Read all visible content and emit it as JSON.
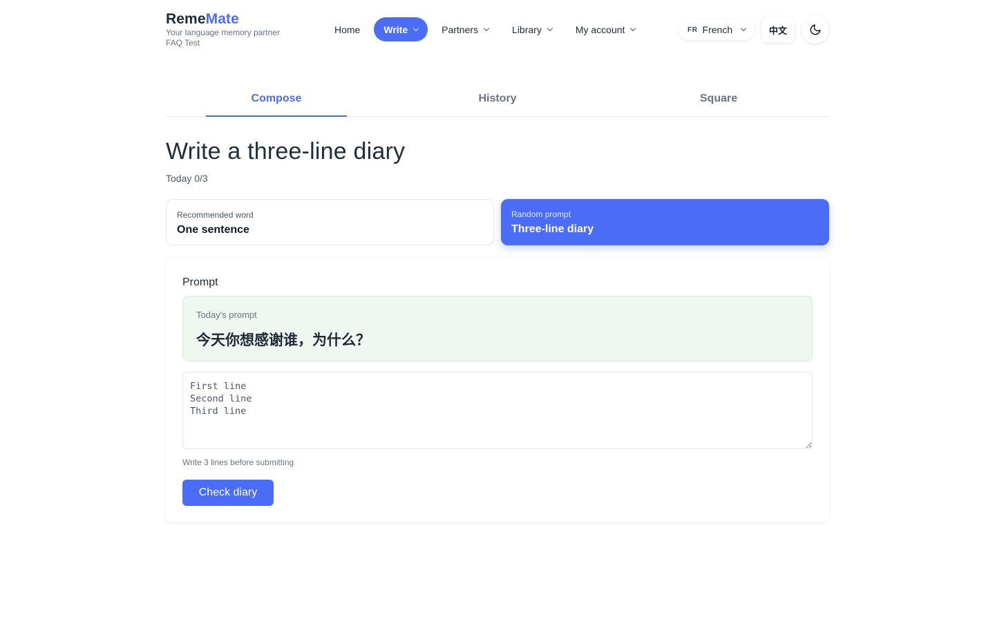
{
  "brand": {
    "name_part1": "Reme",
    "name_part2": "Mate",
    "tagline": "Your language memory partner",
    "subtitle": "FAQ Test"
  },
  "nav": {
    "items": [
      {
        "label": "Home",
        "active": false,
        "dropdown": false
      },
      {
        "label": "Write",
        "active": true,
        "dropdown": true
      },
      {
        "label": "Partners",
        "active": false,
        "dropdown": true
      },
      {
        "label": "Library",
        "active": false,
        "dropdown": true
      },
      {
        "label": "My account",
        "active": false,
        "dropdown": true
      }
    ],
    "language": {
      "code": "FR",
      "label": "French"
    },
    "zh_toggle": "中文",
    "theme_icon": "moon-icon"
  },
  "tabs": [
    {
      "label": "Compose",
      "active": true
    },
    {
      "label": "History",
      "active": false
    },
    {
      "label": "Square",
      "active": false
    }
  ],
  "main": {
    "title": "Write a three-line diary",
    "today_count": "Today 0/3",
    "options": {
      "word": {
        "label": "Recommended word",
        "value": "One sentence"
      },
      "random": {
        "label": "Random prompt",
        "value": "Three-line diary"
      }
    },
    "section_label": "Prompt",
    "prompt": {
      "label": "Today's prompt",
      "text": "今天你想感谢谁，为什么？"
    },
    "diary_placeholder": "First line\nSecond line\nThird line",
    "hint": "Write 3 lines before submitting",
    "submit_label": "Check diary"
  },
  "colors": {
    "accent": "#4a6cf7",
    "prompt_bg": "#eef7f0",
    "text": "#1f2937",
    "muted": "#6b7280"
  }
}
